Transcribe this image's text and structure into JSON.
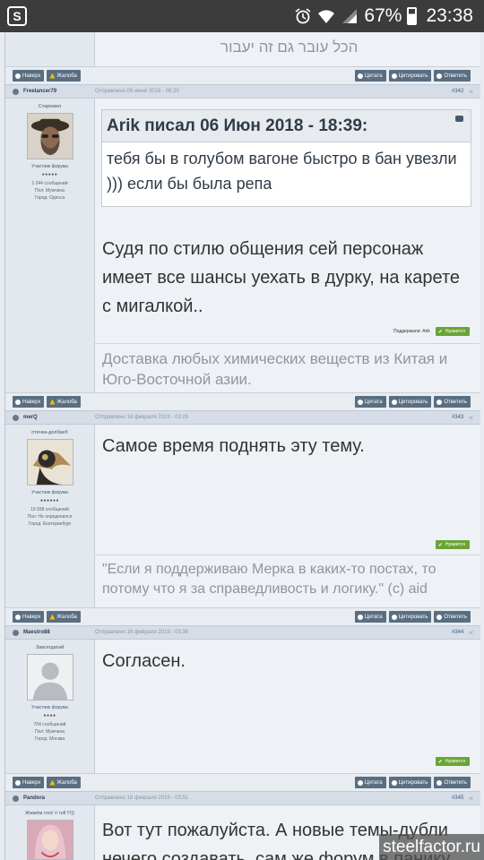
{
  "status_bar": {
    "app_icon": "S",
    "battery": "67%",
    "time": "23:38",
    "icons": [
      "alarm-icon",
      "wifi-icon",
      "signal-icon",
      "battery-icon"
    ]
  },
  "buttons": {
    "report": "Наверх",
    "complaint": "Жалоба",
    "quote": "Цитата",
    "cite": "Цитировать",
    "reply": "Ответить",
    "like": "Нравится"
  },
  "top_signature": "הכל עובר גם זה יעבור",
  "posts": [
    {
      "user": "Freelancer79",
      "date": "Отправлено 09 июня 2018 - 09:20",
      "number": "#342",
      "title": "Старожил",
      "rank": "Участник форума",
      "stars": "●●●●●",
      "stat_posts": "1 244 сообщений",
      "stat_gender": "Пол: Мужчина",
      "stat_city": "Город: Одесса",
      "quote_head": "Arik писал 06 Июн 2018 - 18:39:",
      "quote_body": "тебя бы в голубом вагоне быстро в бан увезли ))) если бы была репа",
      "text": "Судя по стилю общения сей персонаж имеет все шансы уехать в дурку, на карете с мигалкой..",
      "likes_label": "Поддержали: Arik",
      "signature": "Доставка любых химических веществ из Китая и Юго-Восточной азии."
    },
    {
      "user": "merQ",
      "date": "Отправлено 18 февраля 2019 - 03:25",
      "number": "#343",
      "title": "птичка-долбаеб",
      "rank": "Участник форума",
      "stars": "●●●●●●",
      "stat_posts": "19 598 сообщений",
      "stat_gender": "Пол: Не определился",
      "stat_city": "Город: Екатеринбург",
      "text": "Самое время поднять эту тему.",
      "signature": "\"Если я поддерживаю Мерка в каких-то постах, то потому что я за справедливость и логику.\" (c) aid"
    },
    {
      "user": "Maestro88",
      "date": "Отправлено 18 февраля 2019 - 03:36",
      "number": "#344",
      "title": "Завсегдатай",
      "rank": "Участник форума",
      "stars": "●●●●",
      "stat_posts": "704 сообщений",
      "stat_gender": "Пол: Мужчина",
      "stat_city": "Город: Москва",
      "text": "Согласен."
    },
    {
      "user": "Pandora",
      "date": "Отправлено 18 февраля 2019 - 03:51",
      "number": "#345",
      "title": "Жжжём rock`n`roll !!!))",
      "text": "Вот тут пожалуйста. А новые темы-дубли нечего создавать, сам же форум в панику"
    }
  ],
  "watermark": "steelfactor.ru"
}
